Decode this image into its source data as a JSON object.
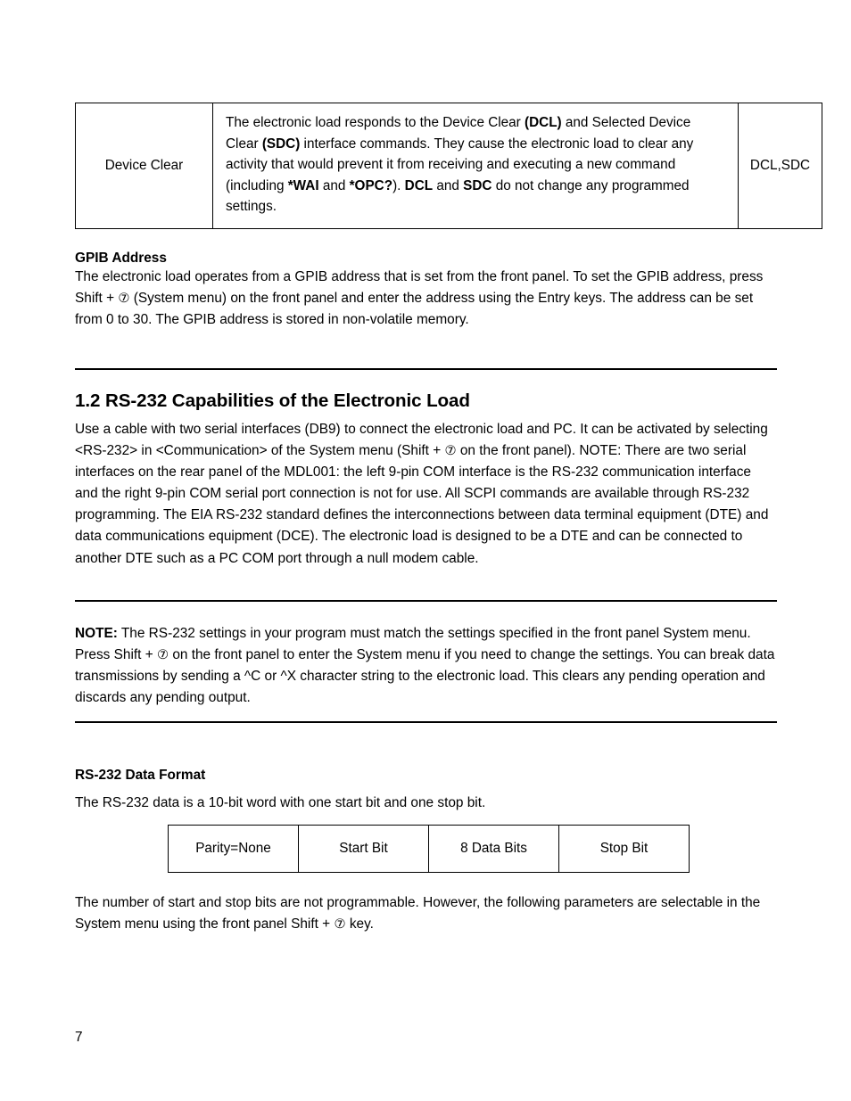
{
  "page": {
    "number": "7"
  },
  "command_table": {
    "rows": [
      {
        "name": "Device Clear",
        "description_runs": [
          {
            "text": "The electronic load responds to the Device Clear ",
            "bold": false
          },
          {
            "text": "(DCL)",
            "bold": true
          },
          {
            "text": " and Selected Device Clear ",
            "bold": false
          },
          {
            "text": "(SDC)",
            "bold": true
          },
          {
            "text": " interface commands. They cause the electronic load to clear any activity that would prevent it from receiving and executing a new command (including ",
            "bold": false
          },
          {
            "text": "*WAI",
            "bold": true
          },
          {
            "text": " and ",
            "bold": false
          },
          {
            "text": "*OPC?",
            "bold": true
          },
          {
            "text": "). ",
            "bold": false
          },
          {
            "text": "DCL",
            "bold": true
          },
          {
            "text": " and ",
            "bold": false
          },
          {
            "text": "SDC",
            "bold": true
          },
          {
            "text": " do not change any programmed settings.",
            "bold": false
          }
        ],
        "mnemonic": "DCL,SDC"
      }
    ]
  },
  "gpib_address": {
    "heading": "GPIB Address",
    "body_runs": [
      {
        "text": "The electronic load operates from a GPIB address that is set from the front panel. To set the GPIB address, press Shift + ",
        "bold": false
      },
      {
        "text": "⑦",
        "circled": true
      },
      {
        "text": " (System menu) on the front panel and enter the address using the Entry keys. The address can be set from 0 to 30. The GPIB address is stored in non-volatile memory.",
        "bold": false
      }
    ]
  },
  "section": {
    "title": "1.2 RS-232 Capabilities of the Electronic Load",
    "body_runs": [
      {
        "text": "Use a cable with two serial interfaces (DB9) to connect the electronic load and PC. It can be activated by selecting <RS-232> in <Communication> of the System menu (Shift + ",
        "bold": false
      },
      {
        "text": "⑦",
        "circled": true
      },
      {
        "text": " on the front panel). NOTE: There are two serial interfaces on the rear panel of the MDL001: the left 9-pin COM interface is the RS-232 communication interface and the right 9-pin COM serial port connection is not for use. All SCPI commands are available through RS-232 programming. The EIA RS-232 standard defines the interconnections between data terminal equipment (DTE) and data communications equipment (DCE). The electronic load is designed to be a DTE and can be connected to another DTE such as a PC COM port through a null modem cable.",
        "bold": false
      }
    ]
  },
  "note": {
    "label": "NOTE:",
    "body_runs": [
      {
        "text": " The RS-232 settings in your program must match the settings specified in the front panel System menu. Press Shift + ",
        "bold": false
      },
      {
        "text": "⑦",
        "circled": true
      },
      {
        "text": " on the front panel to enter the System menu if you need to change the settings. You can break data transmissions by sending a ^C or ^X character string to the electronic load. This clears any pending operation and discards any pending output.",
        "bold": false
      }
    ]
  },
  "data_format": {
    "heading": "RS-232 Data Format",
    "intro": "The RS-232 data is a 10-bit word with one start bit and one stop bit.",
    "table_cells": [
      "Parity=None",
      "Start Bit",
      "8 Data Bits",
      "Stop Bit"
    ],
    "outro_runs": [
      {
        "text": "The number of start and stop bits are not programmable. However, the following parameters are selectable in the System menu using the front panel Shift + ",
        "bold": false
      },
      {
        "text": "⑦",
        "circled": true
      },
      {
        "text": " key.",
        "bold": false
      }
    ]
  }
}
